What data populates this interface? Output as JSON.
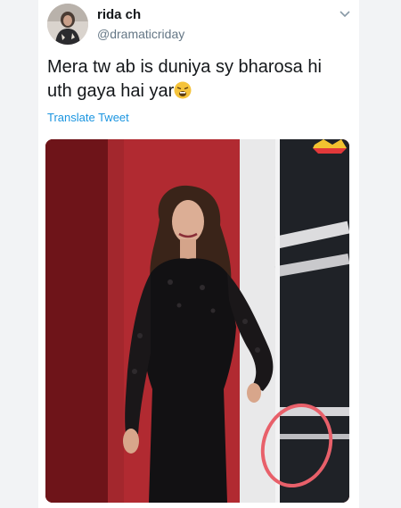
{
  "tweet": {
    "author": {
      "display_name": "rida ch",
      "handle": "@dramaticriday",
      "avatar": "profile-avatar"
    },
    "menu_icon": "chevron-down-icon",
    "text": "Mera tw ab is duniya sy bharosa hi uth gaya hai yar",
    "emoji": "weary-face-emoji",
    "translate_label": "Translate Tweet",
    "media": {
      "description_icon": "photo",
      "highlight": "red-circle-annotation",
      "brand_logo": "tv-channel-logo"
    }
  },
  "colors": {
    "link": "#1b95e0",
    "text": "#14171a",
    "secondary": "#657786",
    "annotation": "#e8606a"
  }
}
